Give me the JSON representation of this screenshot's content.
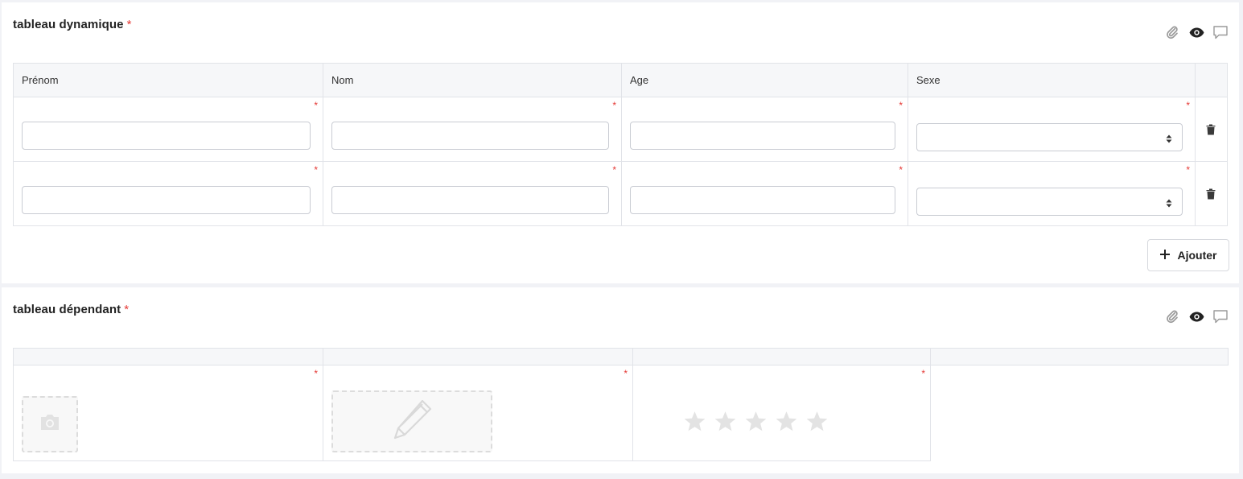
{
  "section1": {
    "title": "tableau dynamique",
    "required_mark": "*",
    "columns": [
      "Prénom",
      "Nom",
      "Age",
      "Sexe"
    ],
    "rows": [
      {
        "prenom": "",
        "nom": "",
        "age": "",
        "sexe": ""
      },
      {
        "prenom": "",
        "nom": "",
        "age": "",
        "sexe": ""
      }
    ],
    "add_label": "Ajouter"
  },
  "section2": {
    "title": "tableau dépendant",
    "required_mark": "*",
    "rating": {
      "max": 5,
      "value": 0
    }
  },
  "colors": {
    "required": "#e53935",
    "header_bg": "#f6f7f9",
    "border": "#e1e3e8",
    "icon_dark": "#333333",
    "icon_light": "#9a9a9a"
  }
}
